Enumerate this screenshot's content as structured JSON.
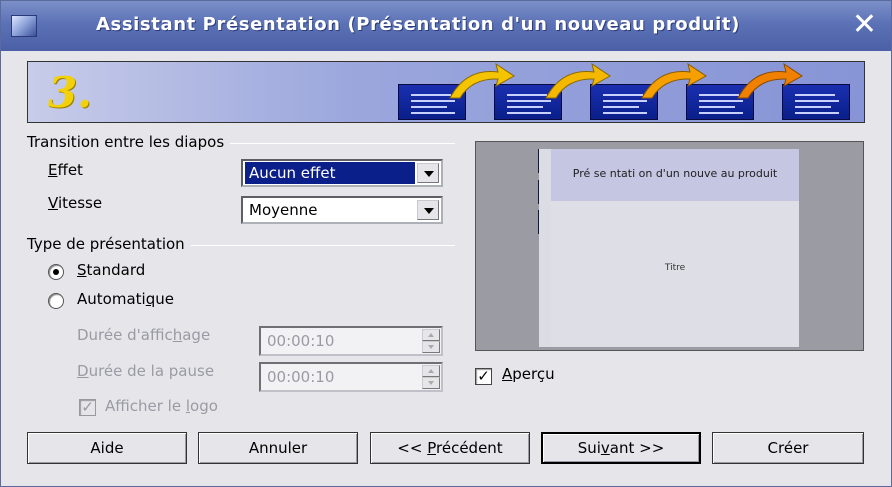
{
  "window": {
    "title": "Assistant Présentation (Présentation d'un nouveau produit)",
    "close_symbol": "✕"
  },
  "banner": {
    "step_number": "3."
  },
  "transition": {
    "group_title": "Transition entre les diapos",
    "effect_label_u": "E",
    "effect_label_rest": "ffet",
    "effect_value": "Aucun effet",
    "speed_label_u": "V",
    "speed_label_rest": "itesse",
    "speed_value": "Moyenne"
  },
  "presentation_type": {
    "group_title": "Type de présentation",
    "standard_u": "S",
    "standard_rest": "tandard",
    "automatic_pre": "Automati",
    "automatic_u": "q",
    "automatic_post": "ue",
    "selected": "standard",
    "display_duration_pre": "Durée d'affic",
    "display_duration_u": "h",
    "display_duration_post": "age",
    "display_duration_value": "00:00:10",
    "pause_duration_u": "D",
    "pause_duration_rest": "urée de la pause",
    "pause_duration_value": "00:00:10",
    "show_logo_pre": "Afficher le ",
    "show_logo_u": "l",
    "show_logo_post": "ogo",
    "show_logo_checked": true
  },
  "preview": {
    "slide_title": "Pré se ntati on d'un nouve au produit",
    "slide_body": "Titre",
    "checkbox_u": "A",
    "checkbox_rest": "perçu",
    "checkbox_checked": true
  },
  "buttons": {
    "help": "Aide",
    "cancel": "Annuler",
    "prev_pre": "<< ",
    "prev_u": "P",
    "prev_post": "récédent",
    "next_pre": "Sui",
    "next_u": "v",
    "next_post": "ant >>",
    "create": "Créer"
  },
  "colors": {
    "titlebar": "#5c72b6",
    "selection": "#0a1f8a",
    "step_number": "#f2d10a"
  }
}
